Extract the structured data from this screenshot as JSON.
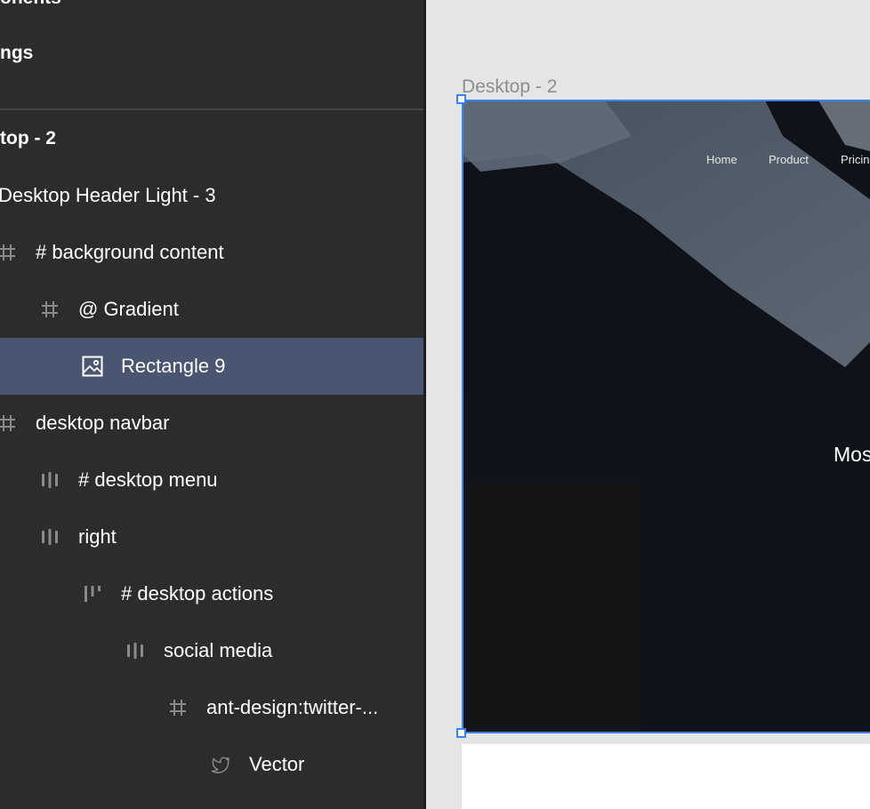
{
  "layers": {
    "top_items": [
      "onents",
      "ngs"
    ],
    "frame_title": "top - 2",
    "rows": [
      {
        "label": "Desktop Header Light - 3",
        "icon": "none"
      },
      {
        "label": "# background content",
        "icon": "frame-icon"
      },
      {
        "label": "@ Gradient",
        "icon": "frame-icon"
      },
      {
        "label": "Rectangle 9",
        "icon": "image-icon",
        "selected": true
      },
      {
        "label": "desktop navbar",
        "icon": "frame-icon"
      },
      {
        "label": "# desktop menu",
        "icon": "autolayout-icon"
      },
      {
        "label": "right",
        "icon": "autolayout-icon"
      },
      {
        "label": "# desktop actions",
        "icon": "autolayout-icon"
      },
      {
        "label": "social media",
        "icon": "autolayout-icon"
      },
      {
        "label": "ant-design:twitter-...",
        "icon": "frame-icon"
      },
      {
        "label": "Vector",
        "icon": "twitter-icon"
      }
    ]
  },
  "canvas": {
    "frame_label": "Desktop - 2",
    "nav_links": [
      "Home",
      "Product",
      "Pricin"
    ],
    "hero_text": "Mos"
  },
  "colors": {
    "panel_bg": "#2c2c2c",
    "selection": "#4a5572",
    "frame_border": "#3b82f6",
    "canvas_bg": "#e5e5e5"
  }
}
